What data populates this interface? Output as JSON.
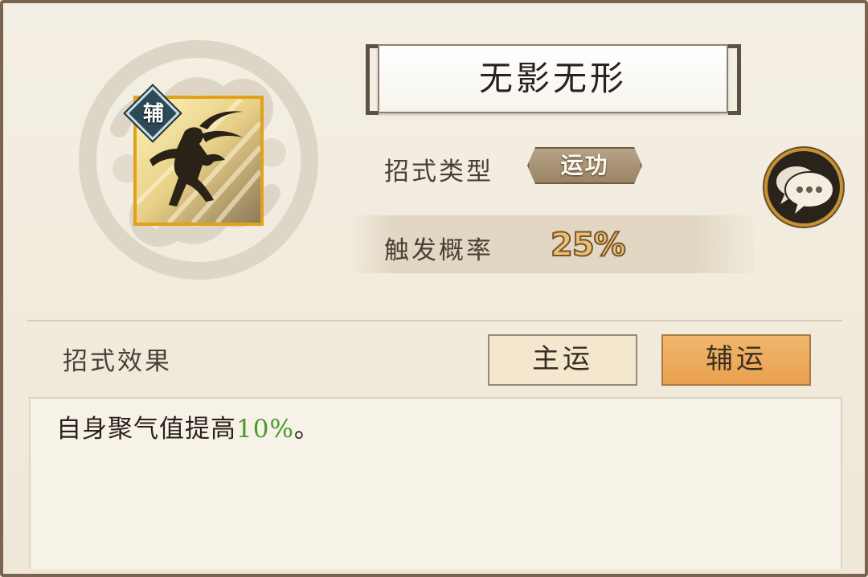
{
  "skill": {
    "name": "无影无形",
    "badge": "辅",
    "icon": "running-warrior-silhouette-icon"
  },
  "info": {
    "type_label": "招式类型",
    "type_value": "运功",
    "prob_label": "触发概率",
    "prob_value": "25%"
  },
  "effect": {
    "label": "招式效果",
    "tabs": {
      "main": "主运",
      "aux": "辅运"
    },
    "text_prefix": "自身聚气值提高",
    "text_highlight": "10%",
    "text_suffix": "。"
  },
  "colors": {
    "selected_tab": "#e9a14f",
    "highlight": "#4a9a2a",
    "icon_border": "#e0a11c"
  }
}
